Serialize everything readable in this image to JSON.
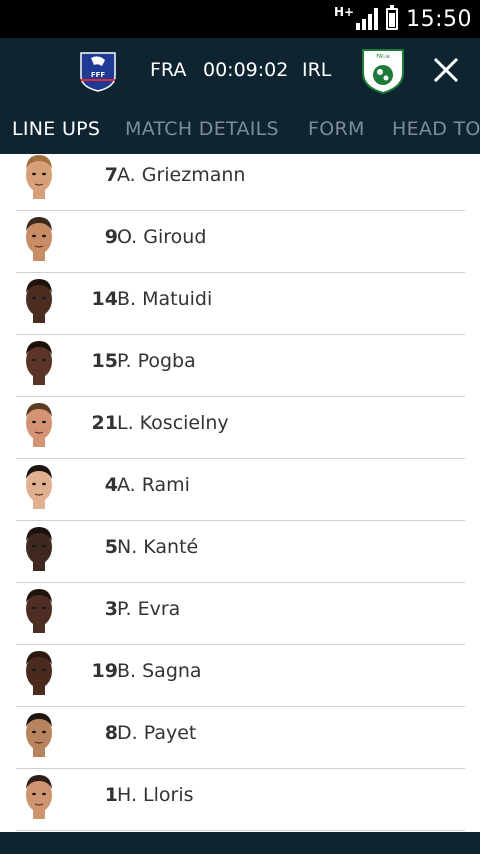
{
  "status_bar": {
    "network": "H+",
    "signal_level": 4,
    "battery_level": 0.9,
    "time": "15:50"
  },
  "match": {
    "home_team": "FRA",
    "clock": "00:09:02",
    "away_team": "IRL",
    "home_crest_text": "FFF",
    "away_crest_text": "FAI.ie/ireland",
    "close_icon": "close-icon"
  },
  "tabs": [
    {
      "label": "LINE UPS",
      "active": true
    },
    {
      "label": "MATCH DETAILS",
      "active": false
    },
    {
      "label": "FORM",
      "active": false
    },
    {
      "label": "HEAD TO",
      "active": false
    }
  ],
  "players": [
    {
      "number": "7",
      "name": "A. Griezmann",
      "skin": "#d8a078",
      "hair": "#a07040"
    },
    {
      "number": "9",
      "name": "O. Giroud",
      "skin": "#c98d66",
      "hair": "#3a2a1e"
    },
    {
      "number": "14",
      "name": "B. Matuidi",
      "skin": "#4a2c20",
      "hair": "#1e120c"
    },
    {
      "number": "15",
      "name": "P. Pogba",
      "skin": "#5a3426",
      "hair": "#1a100a"
    },
    {
      "number": "21",
      "name": "L. Koscielny",
      "skin": "#d49474",
      "hair": "#5a3a22"
    },
    {
      "number": "4",
      "name": "A. Rami",
      "skin": "#e0b090",
      "hair": "#1c1410"
    },
    {
      "number": "5",
      "name": "N. Kanté",
      "skin": "#3e2820",
      "hair": "#1a100c"
    },
    {
      "number": "3",
      "name": "P. Evra",
      "skin": "#4e2e22",
      "hair": "#1e120c"
    },
    {
      "number": "19",
      "name": "B. Sagna",
      "skin": "#4a2a1e",
      "hair": "#2a1a10"
    },
    {
      "number": "8",
      "name": "D. Payet",
      "skin": "#b8845e",
      "hair": "#1e1410"
    },
    {
      "number": "1",
      "name": "H. Lloris",
      "skin": "#cf9570",
      "hair": "#2e2018"
    }
  ]
}
